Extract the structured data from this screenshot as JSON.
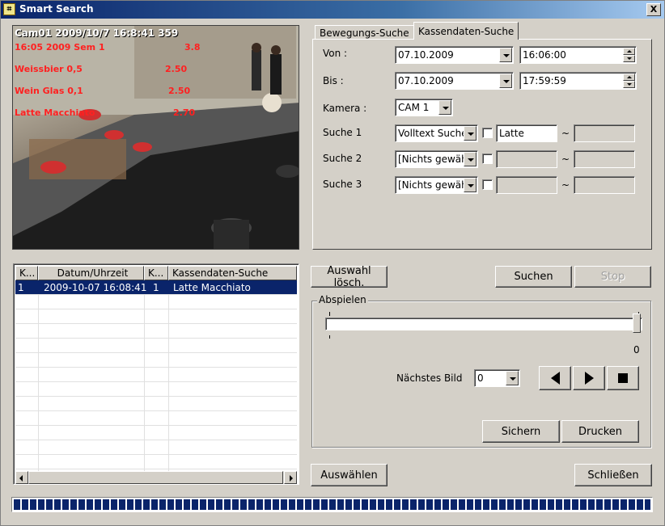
{
  "window": {
    "title": "Smart Search",
    "close_glyph": "X"
  },
  "video": {
    "overlay_header": "Cam01 2009/10/7 16:8:41 359",
    "overlay_lines": [
      {
        "text": "16:05 2009 Sem 1",
        "price": "3.8"
      },
      {
        "text": "Weissbier 0,5",
        "price": "2.50"
      },
      {
        "text": "Wein Glas 0,1",
        "price": "2.50"
      },
      {
        "text": "Latte Macchiato",
        "price": "2.70"
      }
    ]
  },
  "tabs": [
    {
      "label": "Bewegungs-Suche",
      "active": false
    },
    {
      "label": "Kassendaten-Suche",
      "active": true
    }
  ],
  "search": {
    "von_label": "Von :",
    "von_date": "07.10.2009",
    "von_time": "16:06:00",
    "bis_label": "Bis :",
    "bis_date": "07.10.2009",
    "bis_time": "17:59:59",
    "kamera_label": "Kamera :",
    "kamera_value": "CAM 1",
    "rows": [
      {
        "label": "Suche 1",
        "type": "Volltext Suche",
        "checked": false,
        "value1": "Latte",
        "value2": ""
      },
      {
        "label": "Suche 2",
        "type": "[Nichts gewäh",
        "checked": false,
        "value1": "",
        "value2": ""
      },
      {
        "label": "Suche 3",
        "type": "[Nichts gewäh",
        "checked": false,
        "value1": "",
        "value2": ""
      }
    ],
    "tilde": "~"
  },
  "results": {
    "columns": [
      "K...",
      "Datum/Uhrzeit",
      "K...",
      "Kassendaten-Suche"
    ],
    "rows": [
      {
        "k1": "1",
        "datetime": "2009-10-07 16:08:41",
        "k2": "1",
        "text": "Latte Macchiato",
        "selected": true
      }
    ]
  },
  "buttons": {
    "auswahl_loesch": "Auswahl lösch.",
    "suchen": "Suchen",
    "stop": "Stop",
    "sichern": "Sichern",
    "drucken": "Drucken",
    "auswaehlen": "Auswählen",
    "schliessen": "Schließen"
  },
  "playback": {
    "group_label": "Abspielen",
    "slider_value": "0",
    "naechstes_bild_label": "Nächstes Bild",
    "naechstes_bild_value": "0"
  },
  "progress": {
    "fraction": 1.0
  },
  "colors": {
    "titlebar_start": "#0a246a",
    "selection": "#0a246a",
    "overlay_text": "#ff2020"
  }
}
